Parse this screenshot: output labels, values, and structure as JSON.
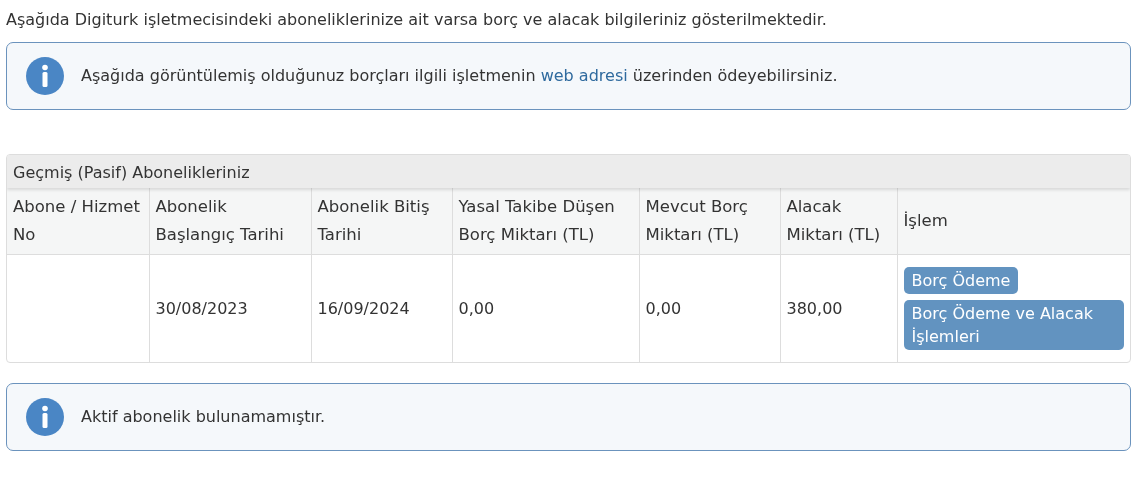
{
  "intro": "Aşağıda Digiturk işletmecisindeki aboneliklerinize ait varsa borç ve alacak bilgileriniz gösterilmektedir.",
  "notice": {
    "before": "Aşağıda görüntülemiş olduğunuz borçları ilgili işletmenin ",
    "link": "web adresi",
    "after": " üzerinden ödeyebilirsiniz."
  },
  "panel": {
    "title": "Geçmiş (Pasif) Abonelikleriniz",
    "columns": [
      "Abone / Hizmet No",
      "Abonelik Başlangıç Tarihi",
      "Abonelik Bitiş Tarihi",
      "Yasal Takibe Düşen Borç Miktarı (TL)",
      "Mevcut Borç Miktarı (TL)",
      "Alacak Miktarı (TL)",
      "İşlem"
    ],
    "rows": [
      {
        "cells": [
          "",
          "30/08/2023",
          "16/09/2024",
          "0,00",
          "0,00",
          "380,00"
        ],
        "actions": [
          "Borç Ödeme",
          "Borç Ödeme ve Alacak İşlemleri"
        ]
      }
    ]
  },
  "empty_notice": "Aktif abonelik bulunamamıştır."
}
